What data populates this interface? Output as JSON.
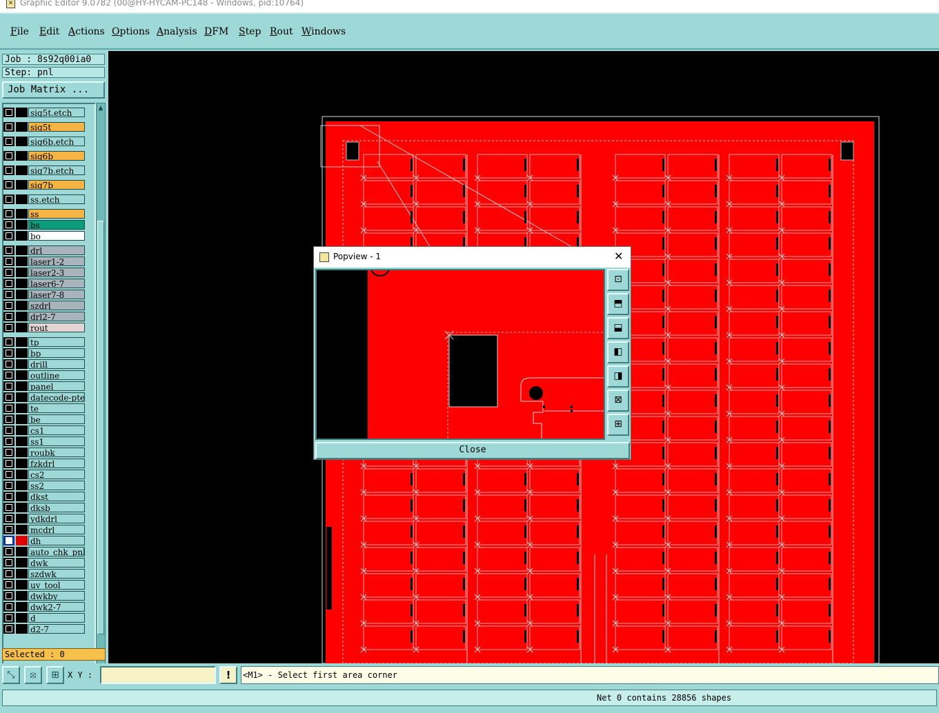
{
  "window": {
    "title": "Graphic Editor 9.0782 (00@HY-HYCAM-PC148 - Windows, pid:10764)",
    "icon": "app-icon"
  },
  "menu": [
    "File",
    "Edit",
    "Actions",
    "Options",
    "Analysis",
    "DFM",
    "Step",
    "Rout",
    "Windows"
  ],
  "job": {
    "job_label": "Job : 8s92q00ia0",
    "step_label": "Step: pnl",
    "matrix_button": "Job Matrix ..."
  },
  "layers": [
    {
      "name": "sig5t.etch",
      "color": "#9ed9d7"
    },
    {
      "name": "sig5t",
      "color": "#f6b444"
    },
    {
      "name": "sig6b.etch",
      "color": "#9ed9d7"
    },
    {
      "name": "sig6b",
      "color": "#f6b444"
    },
    {
      "name": "sig7b.etch",
      "color": "#9ed9d7"
    },
    {
      "name": "sig7b",
      "color": "#f6b444"
    },
    {
      "name": "ss.etch",
      "color": "#9ed9d7"
    },
    {
      "name": "ss",
      "color": "#f6b444"
    },
    {
      "name": "bs",
      "color": "#0c9c7c"
    },
    {
      "name": "bo",
      "color": "#ffffff"
    },
    {
      "name": "drl",
      "color": "#a8b4bc"
    },
    {
      "name": "laser1-2",
      "color": "#a8b4bc"
    },
    {
      "name": "laser2-3",
      "color": "#a8b4bc"
    },
    {
      "name": "laser6-7",
      "color": "#a8b4bc"
    },
    {
      "name": "laser7-8",
      "color": "#a8b4bc"
    },
    {
      "name": "szdrl",
      "color": "#a8b4bc"
    },
    {
      "name": "drl2-7",
      "color": "#a8b4bc"
    },
    {
      "name": "rout",
      "color": "#e4d4d4"
    },
    {
      "name": "tp",
      "color": "#9ed9d7"
    },
    {
      "name": "bp",
      "color": "#9ed9d7"
    },
    {
      "name": "drill",
      "color": "#9ed9d7"
    },
    {
      "name": "outline",
      "color": "#9ed9d7"
    },
    {
      "name": "panel",
      "color": "#9ed9d7"
    },
    {
      "name": "datecode-pte",
      "color": "#9ed9d7"
    },
    {
      "name": "te",
      "color": "#9ed9d7"
    },
    {
      "name": "be",
      "color": "#9ed9d7"
    },
    {
      "name": "cs1",
      "color": "#9ed9d7"
    },
    {
      "name": "ss1",
      "color": "#9ed9d7"
    },
    {
      "name": "roubk",
      "color": "#9ed9d7"
    },
    {
      "name": "fzkdrl",
      "color": "#9ed9d7"
    },
    {
      "name": "cs2",
      "color": "#9ed9d7"
    },
    {
      "name": "ss2",
      "color": "#9ed9d7"
    },
    {
      "name": "dkst",
      "color": "#9ed9d7"
    },
    {
      "name": "dksb",
      "color": "#9ed9d7"
    },
    {
      "name": "ydkdrl",
      "color": "#9ed9d7"
    },
    {
      "name": "mcdrl",
      "color": "#9ed9d7"
    },
    {
      "name": "dh",
      "color": "#9ed9d7",
      "active": true
    },
    {
      "name": "auto_chk_pnl",
      "color": "#9ed9d7"
    },
    {
      "name": "dwk",
      "color": "#9ed9d7"
    },
    {
      "name": "szdwk",
      "color": "#9ed9d7"
    },
    {
      "name": "uv_tool",
      "color": "#9ed9d7"
    },
    {
      "name": "dwkby",
      "color": "#9ed9d7"
    },
    {
      "name": "dwk2-7",
      "color": "#9ed9d7"
    },
    {
      "name": "d",
      "color": "#9ed9d7"
    },
    {
      "name": "d2-7",
      "color": "#9ed9d7"
    }
  ],
  "selected_text": "Selected : 0",
  "bottombar": {
    "xy_label": "X Y :",
    "xy_value": "",
    "warn_label": "!",
    "prompt": "<M1> - Select first area corner"
  },
  "status": "Net 0 contains 28856 shapes",
  "popview": {
    "title": "Popview - 1",
    "close_x": "✕",
    "close_button": "Close"
  },
  "colors": {
    "board": "#ff0000",
    "accent": "#9ed9d7",
    "background": "#000000"
  }
}
